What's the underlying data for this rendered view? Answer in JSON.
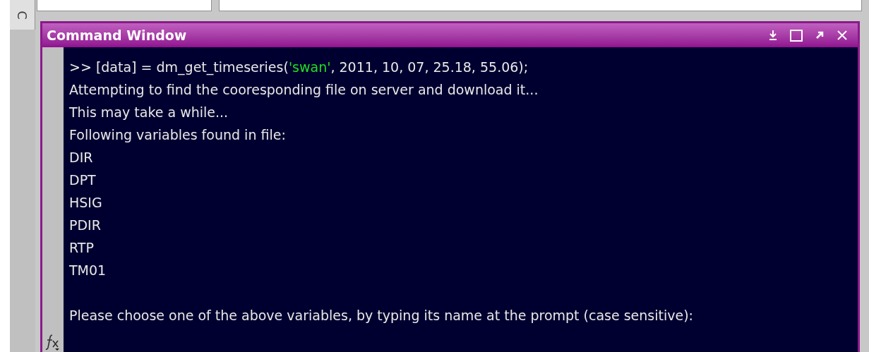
{
  "side_tab": {
    "label": "C"
  },
  "window": {
    "title": "Command Window"
  },
  "console": {
    "lines": [
      {
        "segments": [
          {
            "kind": "plain",
            "text": ">> [data] = dm_get_timeseries("
          },
          {
            "kind": "string",
            "text": "'swan'"
          },
          {
            "kind": "plain",
            "text": ", 2011, 10, 07, 25.18, 55.06);"
          }
        ]
      },
      {
        "segments": [
          {
            "kind": "plain",
            "text": "Attempting to find the cooresponding file on server and download it..."
          }
        ]
      },
      {
        "segments": [
          {
            "kind": "plain",
            "text": "This may take a while..."
          }
        ]
      },
      {
        "segments": [
          {
            "kind": "plain",
            "text": "Following variables found in file:"
          }
        ]
      },
      {
        "segments": [
          {
            "kind": "plain",
            "text": "DIR"
          }
        ]
      },
      {
        "segments": [
          {
            "kind": "plain",
            "text": "DPT"
          }
        ]
      },
      {
        "segments": [
          {
            "kind": "plain",
            "text": "HSIG"
          }
        ]
      },
      {
        "segments": [
          {
            "kind": "plain",
            "text": "PDIR"
          }
        ]
      },
      {
        "segments": [
          {
            "kind": "plain",
            "text": "RTP"
          }
        ]
      },
      {
        "segments": [
          {
            "kind": "plain",
            "text": "TM01"
          }
        ]
      },
      {
        "gap_before": true,
        "segments": [
          {
            "kind": "plain",
            "text": "Please choose one of the above variables, by typing its name at the prompt (case sensitive):"
          }
        ]
      }
    ]
  }
}
